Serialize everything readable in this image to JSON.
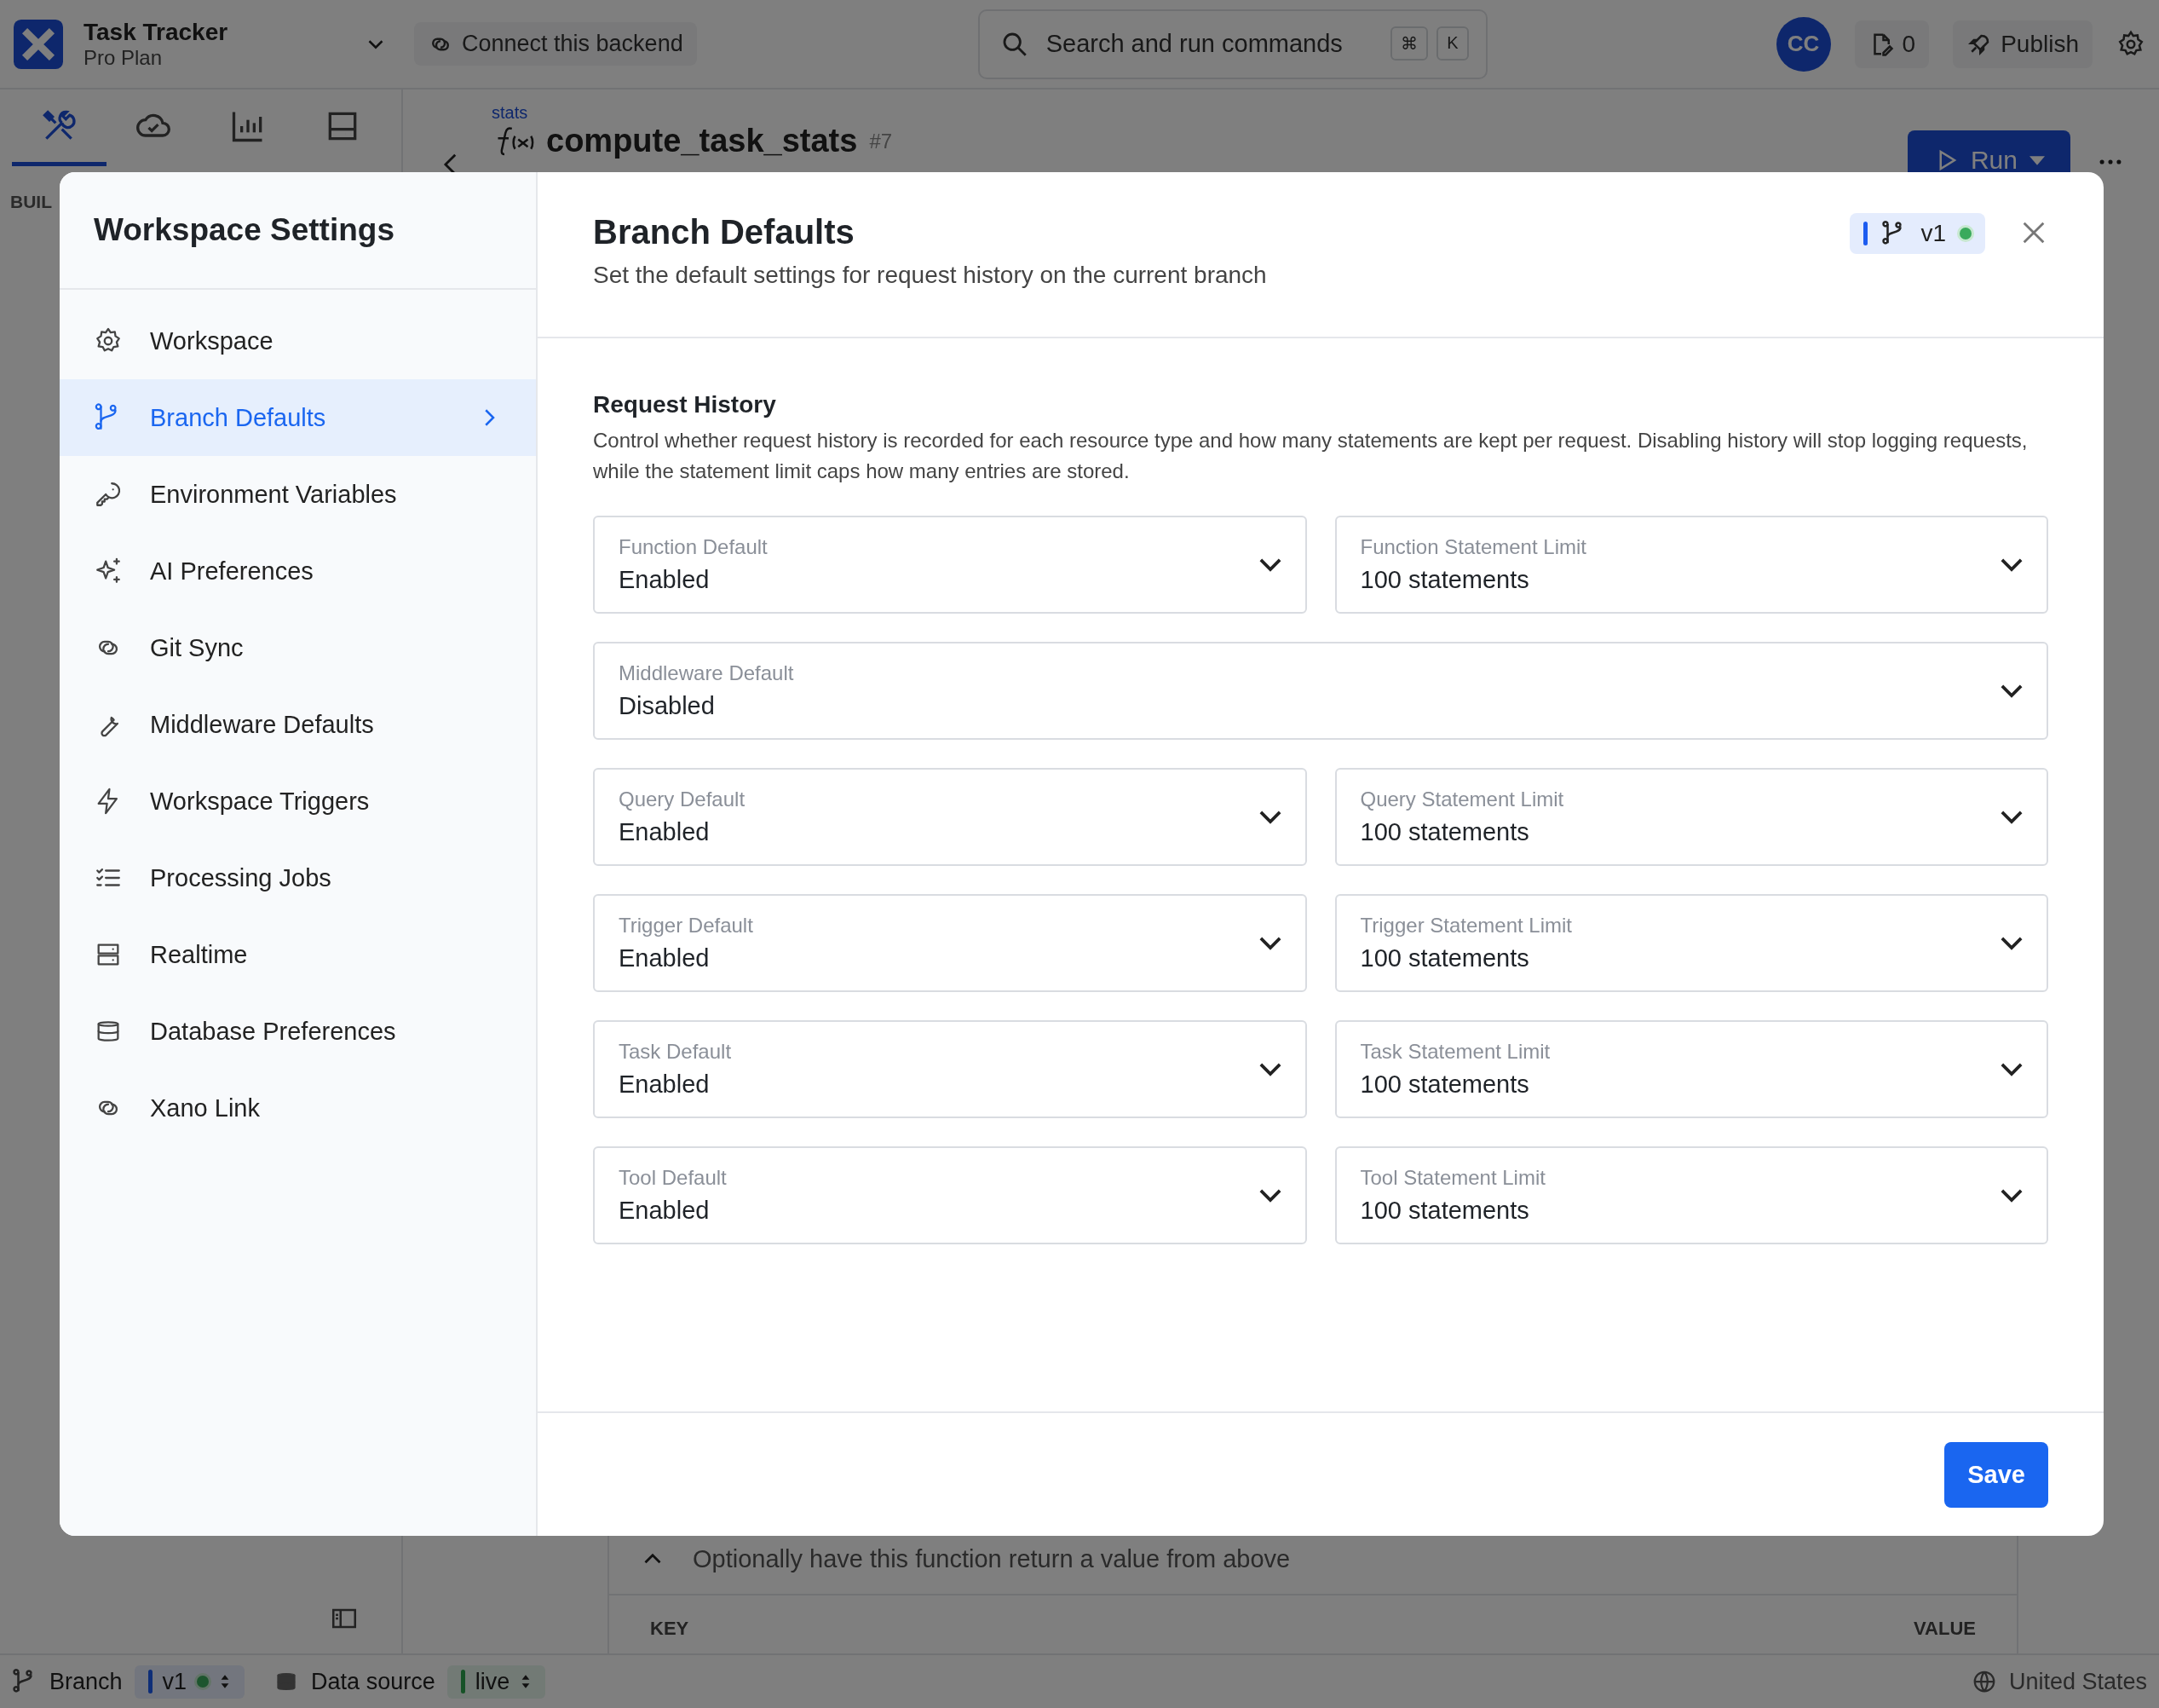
{
  "topbar": {
    "app_name": "Task Tracker",
    "plan": "Pro Plan",
    "connect": "Connect this backend",
    "search": {
      "placeholder": "Search and run commands"
    },
    "shortcut": [
      "⌘",
      "K"
    ],
    "avatar": "CC",
    "count": "0",
    "publish": "Publish"
  },
  "rail": {
    "tabs": [
      {
        "kind": "tools",
        "selected": true
      },
      {
        "kind": "cloud",
        "selected": false
      },
      {
        "kind": "chart",
        "selected": false
      },
      {
        "kind": "panel",
        "selected": false
      }
    ],
    "section": "BUIL"
  },
  "editor": {
    "breadcrumb": "stats",
    "title": "compute_task_stats",
    "badge": "#7",
    "run": "Run"
  },
  "response": {
    "description": "Optionally have this function return a value from above",
    "columns": [
      "KEY",
      "VALUE"
    ]
  },
  "status_bar": {
    "branch_label": "Branch",
    "branch": "v1",
    "source_label": "Data source",
    "source": "live",
    "region": "United States"
  },
  "modal": {
    "title": "Workspace Settings",
    "nav": [
      {
        "label": "Workspace",
        "kind": "gear",
        "selected": false
      },
      {
        "label": "Branch Defaults",
        "kind": "branch",
        "selected": true
      },
      {
        "label": "Environment Variables",
        "kind": "key",
        "selected": false
      },
      {
        "label": "AI Preferences",
        "kind": "sparkle",
        "selected": false
      },
      {
        "label": "Git Sync",
        "kind": "link",
        "selected": false
      },
      {
        "label": "Middleware Defaults",
        "kind": "wrench",
        "selected": false
      },
      {
        "label": "Workspace Triggers",
        "kind": "bolt",
        "selected": false
      },
      {
        "label": "Processing Jobs",
        "kind": "list",
        "selected": false
      },
      {
        "label": "Realtime",
        "kind": "server",
        "selected": false
      },
      {
        "label": "Database Preferences",
        "kind": "database",
        "selected": false
      },
      {
        "label": "Xano Link",
        "kind": "link",
        "selected": false
      }
    ],
    "panel_title": "Branch Defaults",
    "subtitle": "Set the default settings for request history on the current branch",
    "branch_badge": "v1",
    "section_title": "Request History",
    "description": "Control whether request history is recorded for each resource type and how many statements are kept per request. Disabling history will stop logging requests, while the statement limit caps how many entries are stored.",
    "fields": [
      {
        "label": "Function Default",
        "value": "Enabled",
        "kind": "half"
      },
      {
        "label": "Function Statement Limit",
        "value": "100 statements",
        "kind": "half"
      },
      {
        "label": "Middleware Default",
        "value": "Disabled",
        "kind": "full"
      },
      {
        "label": "Query Default",
        "value": "Enabled",
        "kind": "half"
      },
      {
        "label": "Query Statement Limit",
        "value": "100 statements",
        "kind": "half"
      },
      {
        "label": "Trigger Default",
        "value": "Enabled",
        "kind": "half"
      },
      {
        "label": "Trigger Statement Limit",
        "value": "100 statements",
        "kind": "half"
      },
      {
        "label": "Task Default",
        "value": "Enabled",
        "kind": "half"
      },
      {
        "label": "Task Statement Limit",
        "value": "100 statements",
        "kind": "half"
      },
      {
        "label": "Tool Default",
        "value": "Enabled",
        "kind": "half"
      },
      {
        "label": "Tool Statement Limit",
        "value": "100 statements",
        "kind": "half"
      }
    ],
    "save": "Save"
  }
}
